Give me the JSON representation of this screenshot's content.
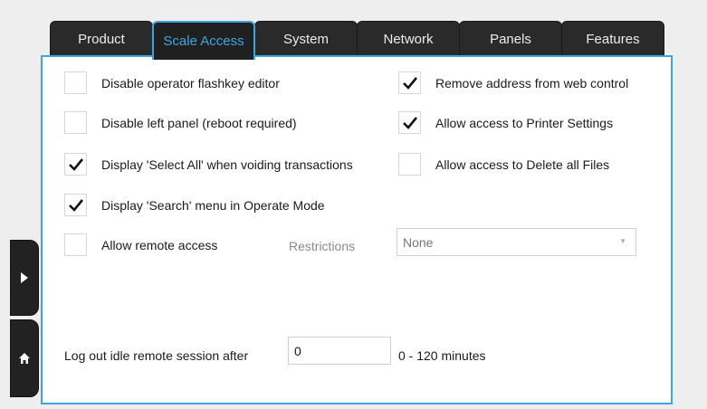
{
  "tabs": [
    {
      "label": "Product",
      "active": false
    },
    {
      "label": "Scale Access",
      "active": true
    },
    {
      "label": "System",
      "active": false
    },
    {
      "label": "Network",
      "active": false
    },
    {
      "label": "Panels",
      "active": false
    },
    {
      "label": "Features",
      "active": false
    }
  ],
  "left_options": [
    {
      "label": "Disable operator flashkey editor",
      "checked": false
    },
    {
      "label": "Disable left panel (reboot required)",
      "checked": false
    },
    {
      "label": "Display 'Select All' when voiding transactions",
      "checked": true
    },
    {
      "label": "Display 'Search' menu in Operate Mode",
      "checked": true
    },
    {
      "label": "Allow remote access",
      "checked": false
    }
  ],
  "right_options": [
    {
      "label": "Remove address from web control",
      "checked": true
    },
    {
      "label": "Allow access to Printer Settings",
      "checked": true
    },
    {
      "label": "Allow access to Delete all Files",
      "checked": false
    }
  ],
  "restrictions": {
    "label": "Restrictions",
    "value": "None"
  },
  "idle_logout": {
    "label": "Log out idle remote session after",
    "value": "0",
    "range_text": "0 - 120 minutes"
  },
  "side_nav": {
    "arrow_icon": "play-arrow-icon",
    "home_icon": "home-icon"
  },
  "colors": {
    "accent": "#3ba7df",
    "tab_bg": "#2a2a2a",
    "panel_bg": "#ffffff",
    "page_bg": "#eeeeee"
  }
}
